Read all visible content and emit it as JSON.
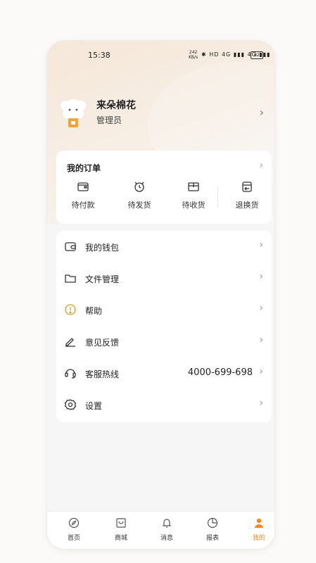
{
  "status_bar": {
    "time": "15:38",
    "net_speed": "242",
    "net_unit": "KB/s",
    "icons": "✱ HD 4G ▮▮▮ 4G ▮▮▮",
    "battery": "82"
  },
  "profile": {
    "name": "来朵棉花",
    "role": "管理员"
  },
  "orders": {
    "title": "我的订单",
    "items": [
      {
        "label": "待付款",
        "icon": "wallet-card-icon"
      },
      {
        "label": "待发货",
        "icon": "alarm-clock-icon"
      },
      {
        "label": "待收货",
        "icon": "box-icon"
      },
      {
        "label": "退换货",
        "icon": "return-box-icon"
      }
    ]
  },
  "menu": [
    {
      "label": "我的钱包",
      "icon": "wallet-icon",
      "value": ""
    },
    {
      "label": "文件管理",
      "icon": "folder-icon",
      "value": ""
    },
    {
      "label": "帮助",
      "icon": "help-icon",
      "value": ""
    },
    {
      "label": "意见反馈",
      "icon": "pen-icon",
      "value": ""
    },
    {
      "label": "客服热线",
      "icon": "headset-icon",
      "value": "4000-699-698"
    },
    {
      "label": "设置",
      "icon": "gear-icon",
      "value": ""
    }
  ],
  "tabbar": [
    {
      "label": "首页",
      "icon": "compass-icon"
    },
    {
      "label": "商城",
      "icon": "shop-icon"
    },
    {
      "label": "消息",
      "icon": "bell-icon"
    },
    {
      "label": "报表",
      "icon": "pie-chart-icon"
    },
    {
      "label": "我的",
      "icon": "person-icon"
    }
  ],
  "colors": {
    "accent": "#f58a1f",
    "hero": "#f6e7d8"
  }
}
